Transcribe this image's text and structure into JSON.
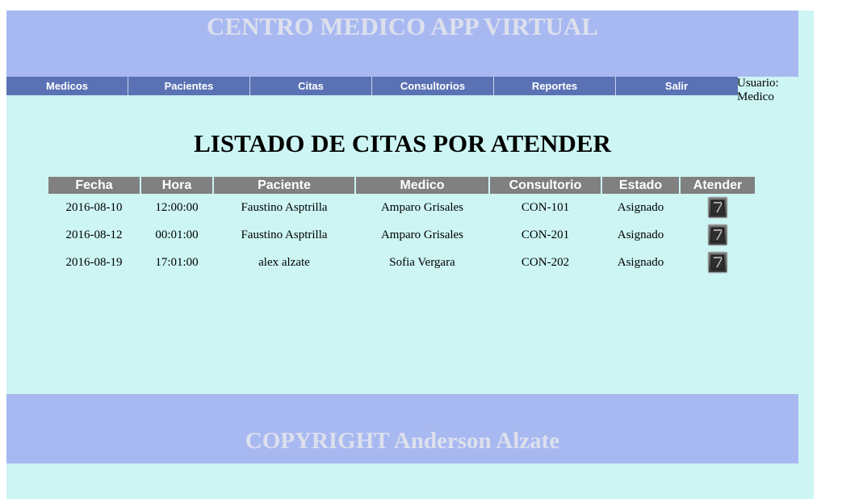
{
  "header": {
    "title": "CENTRO MEDICO APP VIRTUAL"
  },
  "nav": {
    "items": [
      {
        "label": "Medicos"
      },
      {
        "label": "Pacientes"
      },
      {
        "label": "Citas"
      },
      {
        "label": "Consultorios"
      },
      {
        "label": "Reportes"
      },
      {
        "label": "Salir"
      }
    ]
  },
  "user": {
    "label": "Usuario:",
    "name": "Medico"
  },
  "main": {
    "title": "LISTADO DE CITAS POR ATENDER",
    "columns": [
      "Fecha",
      "Hora",
      "Paciente",
      "Medico",
      "Consultorio",
      "Estado",
      "Atender"
    ],
    "rows": [
      {
        "fecha": "2016-08-10",
        "hora": "12:00:00",
        "paciente": "Faustino Asptrilla",
        "medico": "Amparo Grisales",
        "consultorio": "CON-101",
        "estado": "Asignado"
      },
      {
        "fecha": "2016-08-12",
        "hora": "00:01:00",
        "paciente": "Faustino Asptrilla",
        "medico": "Amparo Grisales",
        "consultorio": "CON-201",
        "estado": "Asignado"
      },
      {
        "fecha": "2016-08-19",
        "hora": "17:01:00",
        "paciente": "alex alzate",
        "medico": "Sofia Vergara",
        "consultorio": "CON-202",
        "estado": "Asignado"
      }
    ],
    "action_icon": "edit-icon"
  },
  "footer": {
    "text": "COPYRIGHT Anderson Alzate"
  },
  "colors": {
    "page_bg": "#ccf5f3",
    "banner_bg": "#a8b9f2",
    "banner_text": "#dde0ec",
    "nav_bg": "#5a72b4",
    "table_header_bg": "#808080"
  }
}
